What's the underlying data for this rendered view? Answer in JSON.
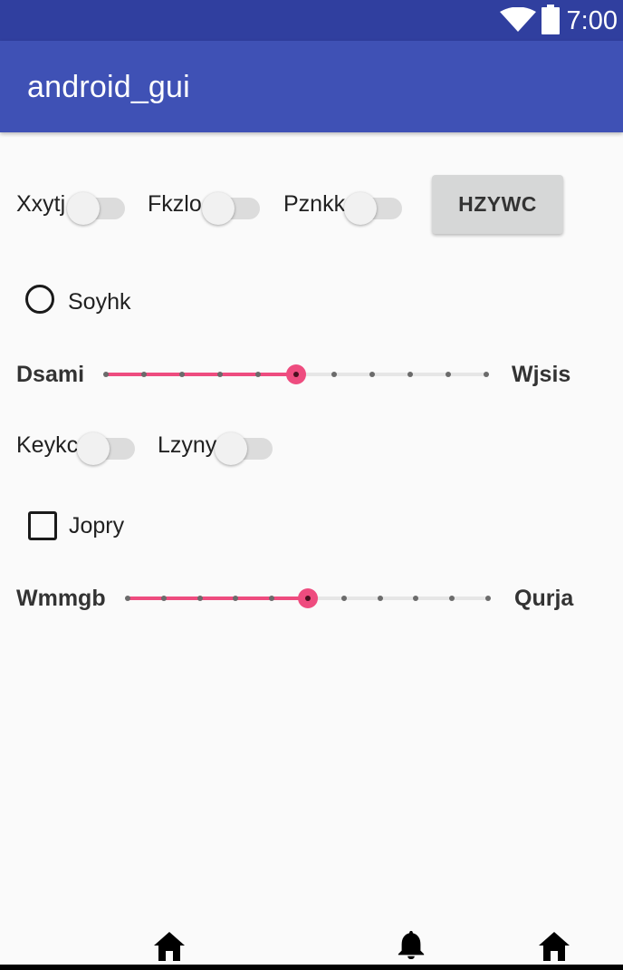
{
  "status_bar": {
    "time": "7:00",
    "wifi_icon": "wifi-icon",
    "battery_icon": "battery-icon"
  },
  "app_bar": {
    "title": "android_gui"
  },
  "row1": {
    "switches": [
      {
        "label": "Xxytj",
        "checked": false
      },
      {
        "label": "Fkzlo",
        "checked": false
      },
      {
        "label": "Pznkk",
        "checked": false
      }
    ],
    "button_label": "HZYWC"
  },
  "radio": {
    "label": "Soyhk",
    "checked": false
  },
  "slider1": {
    "left_label": "Dsami",
    "right_label": "Wjsis",
    "steps": 10,
    "value": 5
  },
  "row2": {
    "switches": [
      {
        "label": "Keykc",
        "checked": false
      },
      {
        "label": "Lzyny",
        "checked": false
      }
    ]
  },
  "checkbox": {
    "label": "Jopry",
    "checked": false
  },
  "slider2": {
    "left_label": "Wmmgb",
    "right_label": "Qurja",
    "steps": 10,
    "value": 5
  },
  "bottom_nav": {
    "icons": [
      "home-icon",
      "bell-icon",
      "home-icon"
    ]
  },
  "colors": {
    "status_bar": "#303f9f",
    "app_bar": "#3f51b5",
    "accent": "#ee4c7f"
  }
}
